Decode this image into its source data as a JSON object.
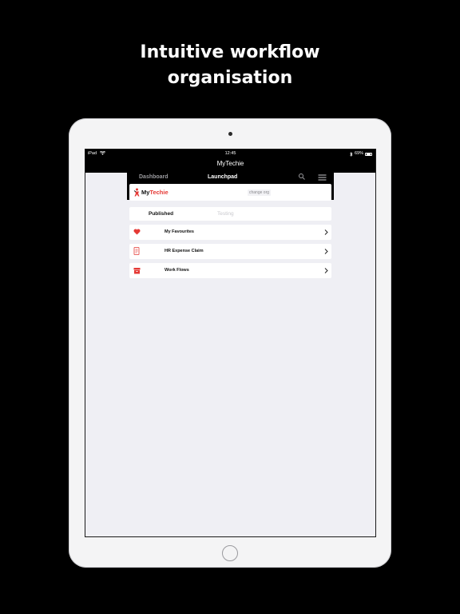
{
  "headline": {
    "line1": "Intuitive workflow",
    "line2": "organisation"
  },
  "status_bar": {
    "device": "iPad",
    "time": "12:45",
    "battery": "69%"
  },
  "app": {
    "title": "MyTechie"
  },
  "nav": {
    "tabs": [
      {
        "label": "Dashboard",
        "active": false
      },
      {
        "label": "Launchpad",
        "active": true
      }
    ],
    "icons": [
      "search-icon",
      "menu-icon"
    ]
  },
  "org": {
    "logo_my": "My",
    "logo_techie": "Techie",
    "change_org": "change org"
  },
  "segments": [
    {
      "label": "Published",
      "selected": true
    },
    {
      "label": "Testing",
      "selected": false
    }
  ],
  "launchpad_items": [
    {
      "label": "My Favourites",
      "icon": "heart-icon"
    },
    {
      "label": "HR Expense Claim",
      "icon": "receipt-icon"
    },
    {
      "label": "Work Flows",
      "icon": "box-icon"
    }
  ],
  "colors": {
    "accent": "#e53935",
    "background": "#000000",
    "screen_bg": "#efeff4"
  }
}
